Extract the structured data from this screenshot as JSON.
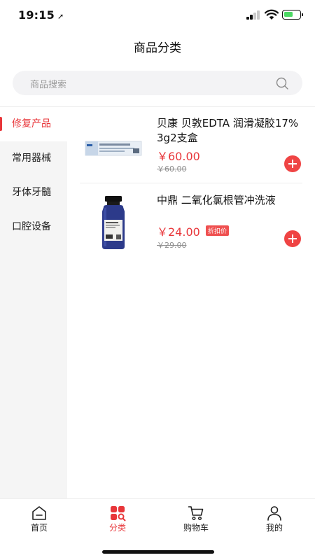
{
  "status_bar": {
    "time": "19:15",
    "location_glyph": "➚"
  },
  "header": {
    "title": "商品分类"
  },
  "search": {
    "placeholder": "商品搜索"
  },
  "categories": [
    {
      "label": "修复产品",
      "active": true
    },
    {
      "label": "常用器械",
      "active": false
    },
    {
      "label": "牙体牙髓",
      "active": false
    },
    {
      "label": "口腔设备",
      "active": false
    }
  ],
  "products": [
    {
      "name": "贝康 贝敦EDTA 润滑凝胶17% 3g2支盒",
      "price": "￥60.00",
      "original_price": "￥60.00",
      "badge": ""
    },
    {
      "name": "中鼎 二氧化氯根管冲洗液",
      "price": "￥24.00",
      "original_price": "￥29.00",
      "badge": "折扣价"
    }
  ],
  "tabbar": {
    "items": [
      {
        "label": "首页",
        "icon": "home-icon",
        "active": false
      },
      {
        "label": "分类",
        "icon": "category-icon",
        "active": true
      },
      {
        "label": "购物车",
        "icon": "cart-icon",
        "active": false
      },
      {
        "label": "我的",
        "icon": "profile-icon",
        "active": false
      }
    ]
  },
  "colors": {
    "accent": "#e8363a",
    "add_button": "#ef4444",
    "sidebar_bg": "#f5f5f5",
    "search_bg": "#f3f3f5"
  }
}
